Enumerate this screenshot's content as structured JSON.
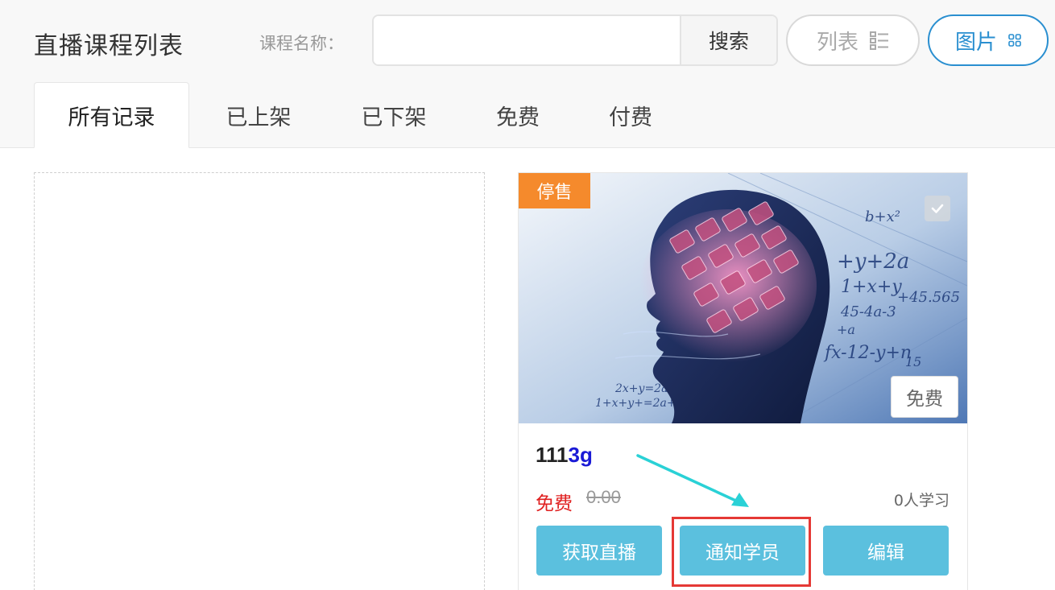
{
  "header": {
    "title": "直播课程列表",
    "search_label": "课程名称：",
    "search_value": "",
    "search_button": "搜索",
    "view_list_label": "列表",
    "view_grid_label": "图片"
  },
  "tabs": [
    {
      "label": "所有记录",
      "active": true
    },
    {
      "label": "已上架"
    },
    {
      "label": "已下架"
    },
    {
      "label": "免费"
    },
    {
      "label": "付费"
    }
  ],
  "add_card": {
    "icon": "plus-icon"
  },
  "course": {
    "status_tag": "停售",
    "price_type_tag": "免费",
    "title_part1": "111",
    "title_part2": "3g",
    "price_label": "免费",
    "original_price": "0.00",
    "learners": "0人学习",
    "buttons": [
      "获取直播",
      "通知学员",
      "编辑"
    ]
  },
  "colors": {
    "accent_blue": "#2a8fd0",
    "action_button": "#5bc0de",
    "status_tag": "#f58a2c",
    "price_red": "#e02020",
    "annotation_red": "#e53935",
    "annotation_arrow": "#2ad1d6"
  }
}
